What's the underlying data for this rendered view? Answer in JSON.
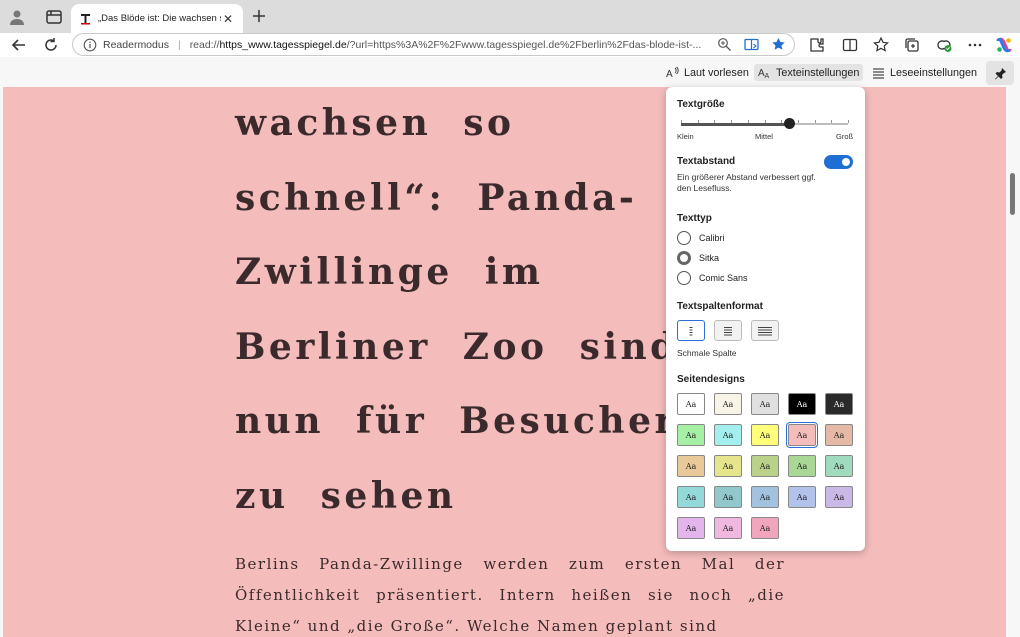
{
  "tab": {
    "title": "„Das Blöde ist: Die wachsen so schnell“",
    "close": "✕"
  },
  "address": {
    "mode_label": "Readermodus",
    "separator": "|",
    "url_prefix": "read://",
    "url_domain": "https_www.tagesspiegel.de",
    "url_rest": "/?url=https%3A%2F%2Fwww.tagesspiegel.de%2Fberlin%2Fdas-blode-ist-..."
  },
  "reader_toolbar": {
    "read_aloud": "Laut vorlesen",
    "text_settings": "Texteinstellungen",
    "reading_settings": "Leseeinstellungen"
  },
  "article": {
    "headline_lines": [
      "wachsen so",
      "schnell“: Panda-",
      "Zwillinge im",
      "Berliner Zoo sind",
      "nun für Besucher",
      "zu sehen"
    ],
    "body": "Berlins Panda-Zwillinge werden zum ersten Mal der Öffentlichkeit präsentiert. Intern heißen sie noch „die Kleine“ und „die Große“. Welche Namen geplant sind"
  },
  "panel": {
    "text_size": {
      "title": "Textgröße",
      "min_label": "Klein",
      "mid_label": "Mittel",
      "max_label": "Groß",
      "value": 0.65
    },
    "spacing": {
      "title": "Textabstand",
      "enabled": true,
      "description": "Ein größerer Abstand verbessert ggf. den Lesefluss."
    },
    "font_type": {
      "title": "Texttyp",
      "options": [
        "Calibri",
        "Sitka",
        "Comic Sans"
      ],
      "selected": "Sitka"
    },
    "column_format": {
      "title": "Textspaltenformat",
      "selected_label": "Schmale Spalte"
    },
    "themes": {
      "title": "Seitendesigns",
      "swatch_label": "Aa",
      "selected": "#f5bcbc",
      "rows": [
        [
          "#ffffff",
          "#f8f4e8",
          "#e0e0e0",
          "#000000",
          "#2a2a2a"
        ],
        [
          "#a6f0a6",
          "#a3efef",
          "#ffff7a",
          "#f5bcbc",
          "#e4b9a5"
        ],
        [
          "#e9c999",
          "#e6e48d",
          "#b9d189",
          "#a9d796",
          "#a0dbbd"
        ],
        [
          "#93d9d9",
          "#90c8cc",
          "#a2c2e0",
          "#b3c2ea",
          "#c8b9e6"
        ],
        [
          "#e3b5ec",
          "#f0b8de",
          "#f2a6bd"
        ]
      ]
    }
  }
}
